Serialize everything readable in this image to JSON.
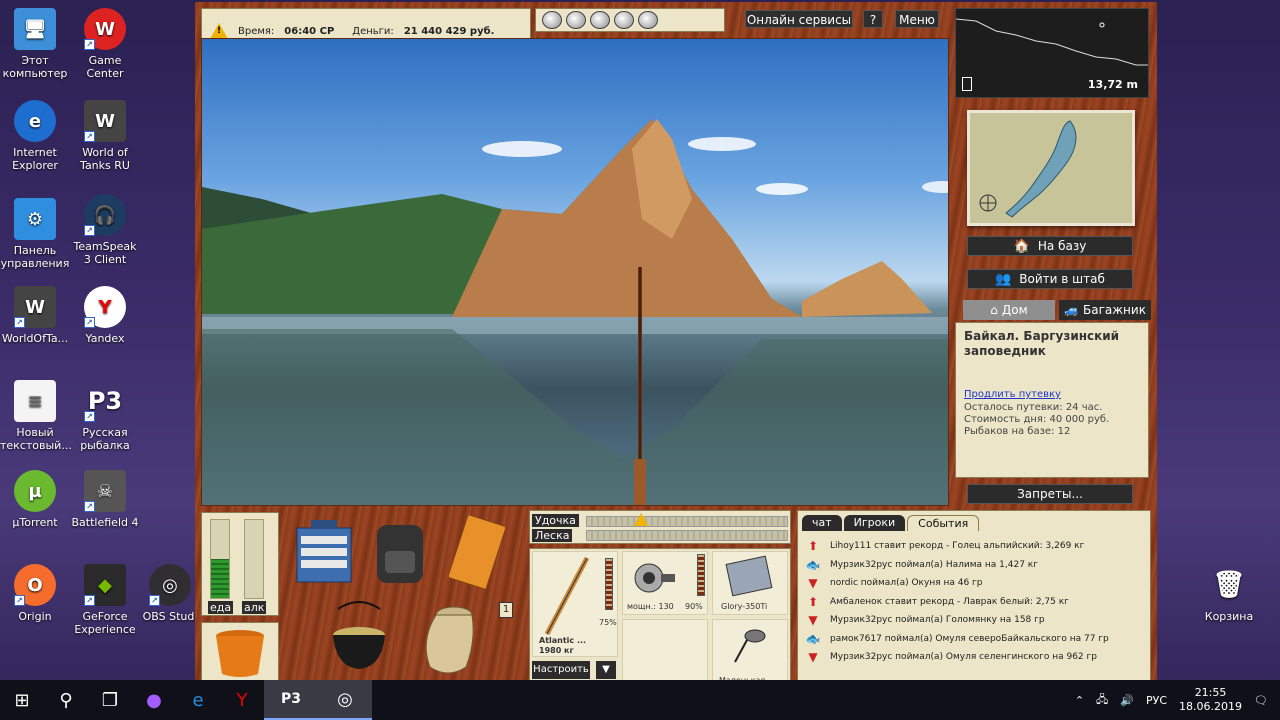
{
  "desktop": {
    "icons": [
      {
        "label": "Этот компьютер",
        "icon": "computer-icon"
      },
      {
        "label": "Game Center",
        "icon": "game-center-icon"
      },
      {
        "label": "Internet Explorer",
        "icon": "ie-icon"
      },
      {
        "label": "World of Tanks RU",
        "icon": "wot-icon"
      },
      {
        "label": "Панель управления",
        "icon": "control-panel-icon"
      },
      {
        "label": "TeamSpeak 3 Client",
        "icon": "teamspeak-icon"
      },
      {
        "label": "WorldOfTa...",
        "icon": "wot-icon"
      },
      {
        "label": "Yandex",
        "icon": "yandex-icon"
      },
      {
        "label": "Новый текстовый...",
        "icon": "text-file-icon"
      },
      {
        "label": "Русская рыбалка",
        "icon": "rf3-icon"
      },
      {
        "label": "µTorrent",
        "icon": "utorrent-icon"
      },
      {
        "label": "Battlefield 4",
        "icon": "bf4-icon"
      },
      {
        "label": "Origin",
        "icon": "origin-icon"
      },
      {
        "label": "GeForce Experience",
        "icon": "geforce-icon"
      },
      {
        "label": "OBS Studi",
        "icon": "obs-icon"
      },
      {
        "label": "Корзина",
        "icon": "recycle-bin-icon"
      }
    ]
  },
  "game": {
    "time_label": "Время:",
    "time_value": "06:40 СР",
    "money_label": "Деньги:",
    "money_value": "21 440 429 руб.",
    "online_services": "Онлайн сервисы",
    "help": "?",
    "menu": "Меню",
    "depth": "13,72 m",
    "to_base": "На базу",
    "enter_hq": "Войти в штаб",
    "tab_home": "Дом",
    "tab_trunk": "Багажник",
    "location": "Байкал. Баргузинский заповедник",
    "extend_link": "Продлить путевку",
    "time_left": "Осталось путевки: 24 час.",
    "day_cost": "Стоимость дня: 40 000 руб.",
    "anglers": "Рыбаков на базе: 12",
    "bans": "Запреты...",
    "food": "еда",
    "alc": "алк",
    "food_level": 0.5,
    "alc_level": 0.0,
    "bait_count": "1",
    "rod_label": "Удочка",
    "line_label": "Леска",
    "rod_name": "Atlantic ...",
    "rod_weight": "1980 кг",
    "rod_pct": "75%",
    "reel_power": "мощн.: 130",
    "reel_pct": "90%",
    "line_name": "Glory-350Ti",
    "lure_name": "Маленькая",
    "setup": "Настроить",
    "tabs": [
      "чат",
      "Игроки",
      "События"
    ],
    "events": [
      {
        "icon": "record-icon",
        "text": "Lihoy111 ставит рекорд - Голец альпийский: 3,269 кг"
      },
      {
        "icon": "fish-icon",
        "text": "Мурзик32рус поймал(а) Налима на 1,427 кг"
      },
      {
        "icon": "float-icon",
        "text": "nordic поймал(а) Окуня на 46 гр"
      },
      {
        "icon": "record-icon",
        "text": "Амбаленок ставит рекорд - Лаврак белый: 2,75 кг"
      },
      {
        "icon": "float-icon",
        "text": "Мурзик32рус поймал(а) Голомянку на 158 гр"
      },
      {
        "icon": "fish-icon",
        "text": "рамок7617 поймал(а) Омуля североБайкальского на 77 гр"
      },
      {
        "icon": "float-icon",
        "text": "Мурзик32рус поймал(а) Омуля селенгинского на 962 гр"
      }
    ]
  },
  "taskbar": {
    "lang": "РУС",
    "time": "21:55",
    "date": "18.06.2019"
  }
}
